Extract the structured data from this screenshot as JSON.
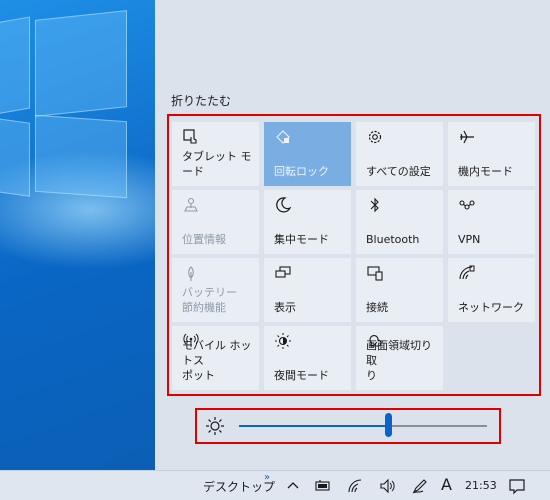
{
  "action_center": {
    "collapse_label": "折りたたむ",
    "tiles": [
      {
        "label": "タブレット モード",
        "icon": "tablet-mode-icon",
        "state": "normal"
      },
      {
        "label": "回転ロック",
        "icon": "rotation-lock-icon",
        "state": "active"
      },
      {
        "label": "すべての設定",
        "icon": "gear-icon",
        "state": "normal"
      },
      {
        "label": "機内モード",
        "icon": "airplane-icon",
        "state": "normal"
      },
      {
        "label": "位置情報",
        "icon": "location-icon",
        "state": "disabled"
      },
      {
        "label": "集中モード",
        "icon": "moon-icon",
        "state": "normal"
      },
      {
        "label": "Bluetooth",
        "icon": "bluetooth-icon",
        "state": "normal"
      },
      {
        "label": "VPN",
        "icon": "vpn-icon",
        "state": "normal"
      },
      {
        "label": "バッテリー\n節約機能",
        "icon": "battery-saver-icon",
        "state": "disabled"
      },
      {
        "label": "表示",
        "icon": "project-icon",
        "state": "normal"
      },
      {
        "label": "接続",
        "icon": "connect-icon",
        "state": "normal"
      },
      {
        "label": "ネットワーク",
        "icon": "network-icon",
        "state": "normal"
      },
      {
        "label": "モバイル ホットス\nポット",
        "icon": "hotspot-icon",
        "state": "normal"
      },
      {
        "label": "夜間モード",
        "icon": "night-light-icon",
        "state": "normal"
      },
      {
        "label": "画面領域切り取\nり",
        "icon": "snip-icon",
        "state": "normal"
      }
    ],
    "brightness": {
      "value": 0.6
    }
  },
  "taskbar": {
    "desktop_label": "デスクトップ",
    "chevrons": "»",
    "ime_mode": "A",
    "time": "21:53"
  },
  "colors": {
    "accent": "#0a64c8",
    "tile_active": "#7aaee2",
    "highlight": "#e00000"
  }
}
